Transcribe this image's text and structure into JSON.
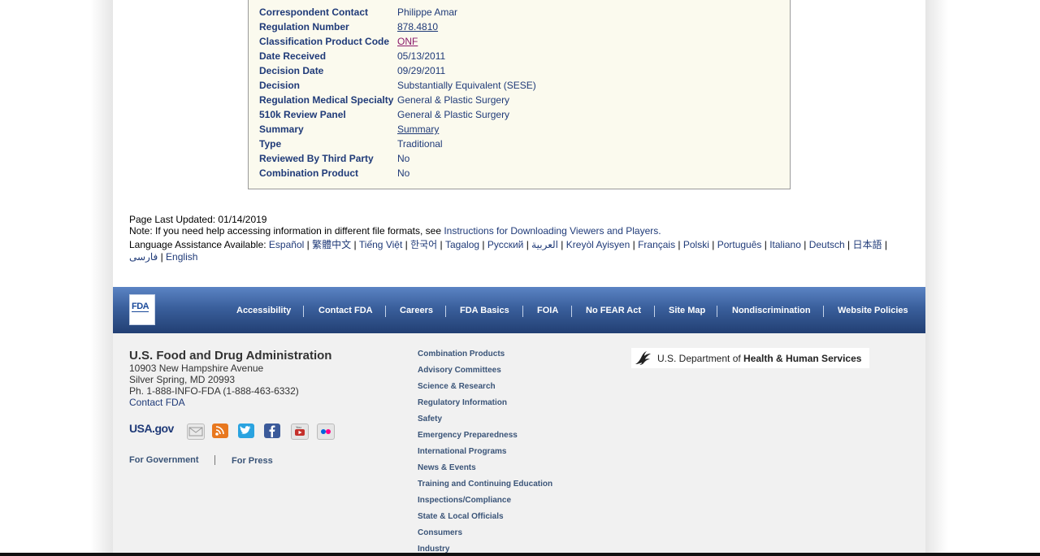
{
  "detail": {
    "rows": [
      {
        "label": "Correspondent Contact",
        "value": "Philippe Amar"
      },
      {
        "label": "Regulation Number",
        "value": "878.4810"
      },
      {
        "label": "Classification Product Code",
        "value": "ONF"
      },
      {
        "label": "Date Received",
        "value": "05/13/2011"
      },
      {
        "label": "Decision Date",
        "value": "09/29/2011"
      },
      {
        "label": "Decision",
        "value": "Substantially Equivalent (SESE)"
      },
      {
        "label": "Regulation Medical Specialty",
        "value": "General & Plastic Surgery"
      },
      {
        "label": "510k Review Panel",
        "value": "General & Plastic Surgery"
      },
      {
        "label": "Summary",
        "value": "Summary"
      },
      {
        "label": "Type",
        "value": "Traditional"
      },
      {
        "label": "Reviewed By Third Party",
        "value": "No"
      },
      {
        "label": "Combination Product",
        "value": "No"
      }
    ]
  },
  "page_info": {
    "last_updated": "Page Last Updated: 01/14/2019",
    "note": "Note: If you need help accessing information in different file formats, see ",
    "note_link": "Instructions for Downloading Viewers and Players.",
    "lang_prefix": "Language Assistance Available: ",
    "languages": [
      "Español",
      "繁體中文",
      "Tiếng Việt",
      "한국어",
      "Tagalog",
      "Русский",
      "العربية",
      "Kreyòl Ayisyen",
      "Français",
      "Polski",
      "Português",
      "Italiano",
      "Deutsch",
      "日本語",
      "فارسی",
      "English"
    ]
  },
  "navbar": {
    "logo_text": "FDA",
    "items": [
      "Accessibility",
      "Contact FDA",
      "Careers",
      "FDA Basics",
      "FOIA",
      "No FEAR Act",
      "Site Map",
      "Nondiscrimination",
      "Website Policies"
    ]
  },
  "footer": {
    "org_name": "U.S. Food and Drug Administration",
    "address1": "10903 New Hampshire Avenue",
    "address2": "Silver Spring, MD 20993",
    "phone": "Ph. 1-888-INFO-FDA (1-888-463-6332)",
    "contact": "Contact FDA",
    "usagov": "USA.gov",
    "social_icons": [
      "email-icon",
      "rss-icon",
      "twitter-icon",
      "facebook-icon",
      "youtube-icon",
      "flickr-icon"
    ],
    "for_government": "For Government",
    "for_press": "For Press",
    "links": [
      "Combination Products",
      "Advisory Committees",
      "Science & Research",
      "Regulatory Information",
      "Safety",
      "Emergency Preparedness",
      "International Programs",
      "News & Events",
      "Training and Continuing Education",
      "Inspections/Compliance",
      "State & Local Officials",
      "Consumers",
      "Industry"
    ],
    "hhs_prefix": "U.S. Department of ",
    "hhs_bold": "Health & Human Services"
  },
  "colors": {
    "link": "#1f3a78",
    "visited_link": "#8a1a6b",
    "nav_top": "#5b84c4",
    "nav_bottom": "#223f73",
    "detail_bg": "#fbfaee"
  }
}
